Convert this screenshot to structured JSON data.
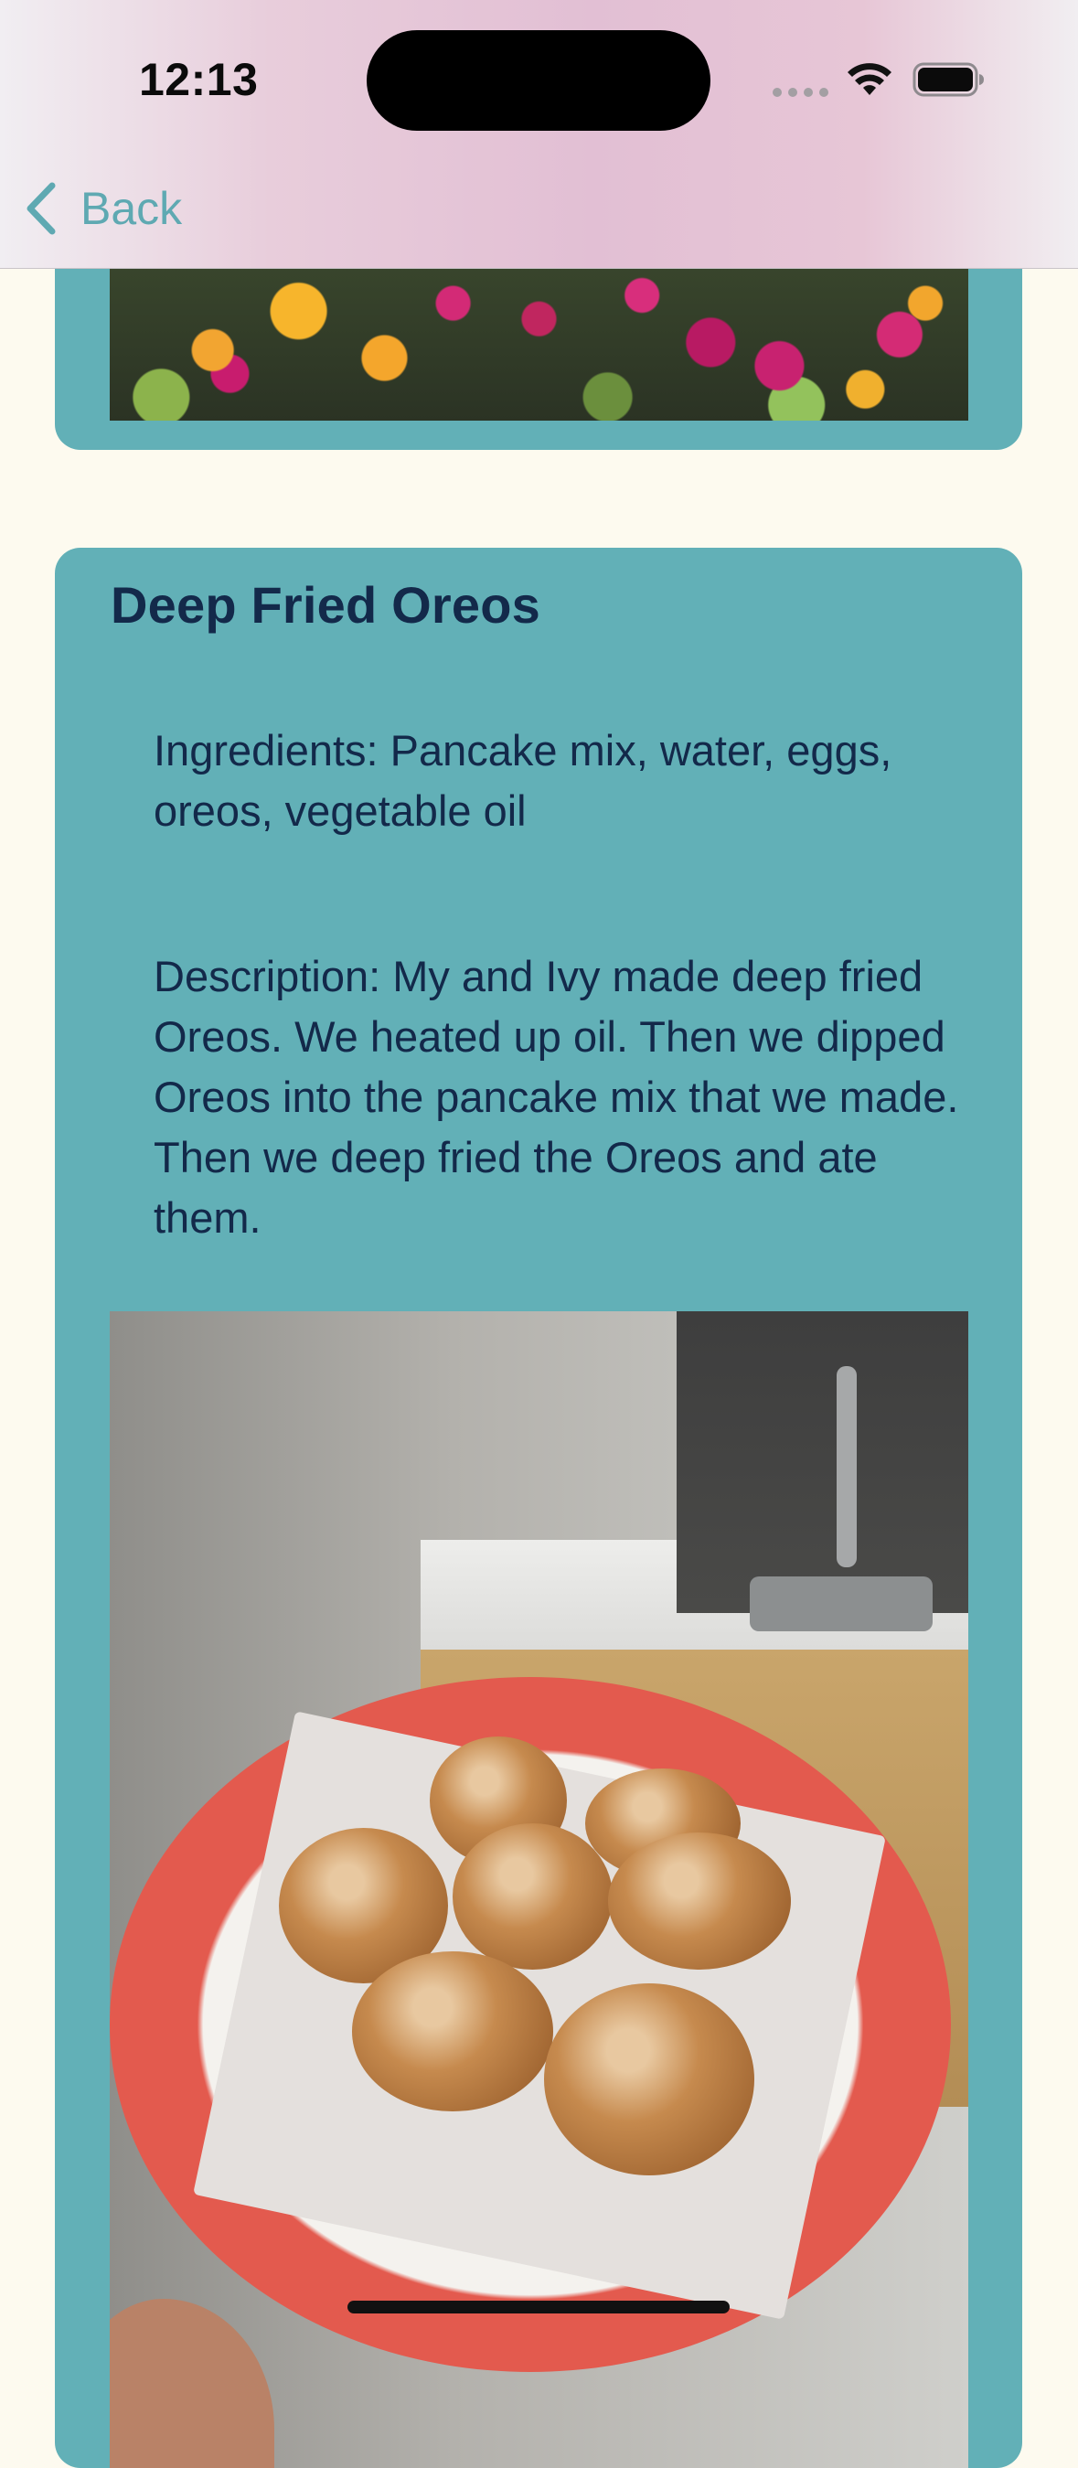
{
  "status_bar": {
    "time": "12:13"
  },
  "nav": {
    "back_label": "Back"
  },
  "post": {
    "title": "Deep Fried Oreos",
    "ingredients": "Ingredients: Pancake mix, water, eggs, oreos, vegetable oil",
    "description": "Description: My and Ivy made deep fried Oreos. We heated up oil. Then we dipped Oreos into the pancake mix that we made. Then we deep fried the Oreos and ate them."
  },
  "colors": {
    "background": "#FDFAEF",
    "card": "#62B0B7",
    "text": "#13294A",
    "accent": "#5FA9B2"
  },
  "icons": {
    "back": "chevron-left-icon",
    "wifi": "wifi-icon",
    "battery": "battery-icon",
    "signal": "cellular-signal-icon"
  }
}
